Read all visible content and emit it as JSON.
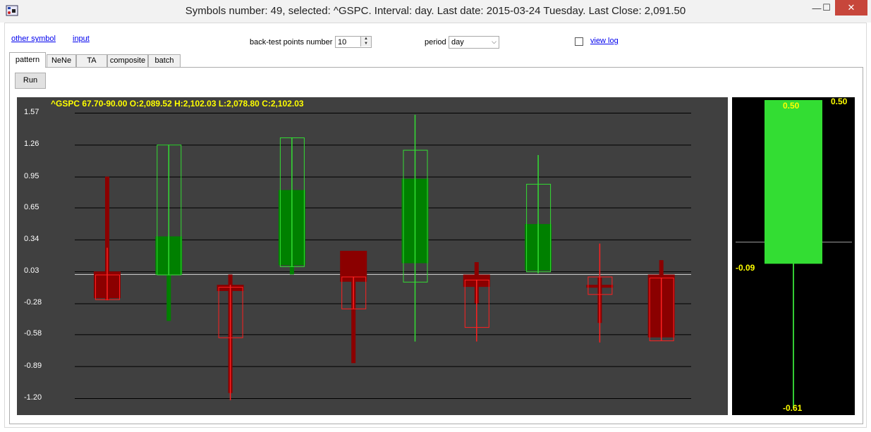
{
  "window": {
    "title": "Symbols number: 49, selected:  ^GSPC. Interval: day.  Last date: 2015-03-24 Tuesday.  Last Close: 2,091.50",
    "minimize": "—",
    "maximize": "☐",
    "close": "✕"
  },
  "toolbar": {
    "other_symbol": "other symbol",
    "input": "input",
    "backtest_label": "back-test points number",
    "backtest_value": "10",
    "period_label": "period",
    "period_value": "day",
    "view_log": "view log",
    "view_log_checked": false
  },
  "tabs": [
    {
      "label": "pattern",
      "active": true
    },
    {
      "label": "NeNe",
      "active": false
    },
    {
      "label": "TA",
      "active": false
    },
    {
      "label": "composite",
      "active": false
    },
    {
      "label": "batch",
      "active": false
    }
  ],
  "run_button": "Run",
  "chart_info": "^GSPC  67.70-90.00    O:2,089.52    H:2,102.03    L:2,078.80    C:2,102.03",
  "colors": {
    "chart_bg": "#404040",
    "side_bg": "#000000",
    "grid": "#000000",
    "axis_text": "#ffffff",
    "info_text": "#ffff00",
    "bull_dark": "#008000",
    "bull_light": "#33dd33",
    "bear_dark": "#8b0000",
    "bear_light": "#ff2020"
  },
  "chart_data": {
    "type": "candlestick",
    "yticks": [
      1.57,
      1.26,
      0.95,
      0.65,
      0.34,
      0.03,
      -0.28,
      -0.58,
      -0.89,
      -1.2
    ],
    "ylim": [
      -1.2,
      1.57
    ],
    "baseline": 0.0,
    "grid": true,
    "candles": [
      {
        "filled": {
          "open": 0.03,
          "close": -0.23,
          "high": 0.95,
          "low": -0.25
        },
        "outline": {
          "open": 0.0,
          "close": -0.24,
          "high": 0.26,
          "low": -0.25
        }
      },
      {
        "filled": {
          "open": 0.0,
          "close": 0.37,
          "high": 0.37,
          "low": -0.45
        },
        "outline": {
          "open": 0.0,
          "close": 1.26,
          "high": 1.26,
          "low": 0.0
        }
      },
      {
        "filled": {
          "open": -0.1,
          "close": -0.16,
          "high": 0.0,
          "low": -1.15
        },
        "outline": {
          "open": -0.12,
          "close": -0.61,
          "high": -0.1,
          "low": -1.22
        }
      },
      {
        "filled": {
          "open": 0.09,
          "close": 0.82,
          "high": 0.82,
          "low": 0.0
        },
        "outline": {
          "open": 0.08,
          "close": 1.33,
          "high": 1.33,
          "low": 0.08
        }
      },
      {
        "filled": {
          "open": 0.23,
          "close": -0.07,
          "high": 0.23,
          "low": -0.86
        },
        "outline": {
          "open": -0.02,
          "close": -0.33,
          "high": -0.02,
          "low": -0.33
        }
      },
      {
        "filled": {
          "open": 0.11,
          "close": 0.93,
          "high": 0.93,
          "low": 0.11
        },
        "outline": {
          "open": -0.07,
          "close": 1.21,
          "high": 1.55,
          "low": -0.65
        }
      },
      {
        "filled": {
          "open": 0.0,
          "close": -0.12,
          "high": 0.12,
          "low": -0.28
        },
        "outline": {
          "open": -0.05,
          "close": -0.51,
          "high": -0.05,
          "low": -0.65
        }
      },
      {
        "filled": {
          "open": 0.04,
          "close": 0.49,
          "high": 0.49,
          "low": 0.04
        },
        "outline": {
          "open": 0.03,
          "close": 0.88,
          "high": 1.16,
          "low": 0.01
        }
      },
      {
        "filled": {
          "open": -0.1,
          "close": -0.12,
          "high": -0.03,
          "low": -0.47
        },
        "outline": {
          "open": -0.02,
          "close": -0.19,
          "high": 0.3,
          "low": -0.66
        }
      },
      {
        "filled": {
          "open": 0.0,
          "close": -0.61,
          "high": 0.14,
          "low": -0.61
        },
        "outline": {
          "open": -0.03,
          "close": -0.64,
          "high": -0.03,
          "low": -0.64
        }
      }
    ],
    "side_candle": {
      "open": -0.09,
      "close": 0.5,
      "high": 0.5,
      "low": -0.61
    },
    "side_labels": {
      "close_inside": "0.50",
      "close_right": "0.50",
      "open": "-0.09",
      "low": "-0.61"
    }
  }
}
